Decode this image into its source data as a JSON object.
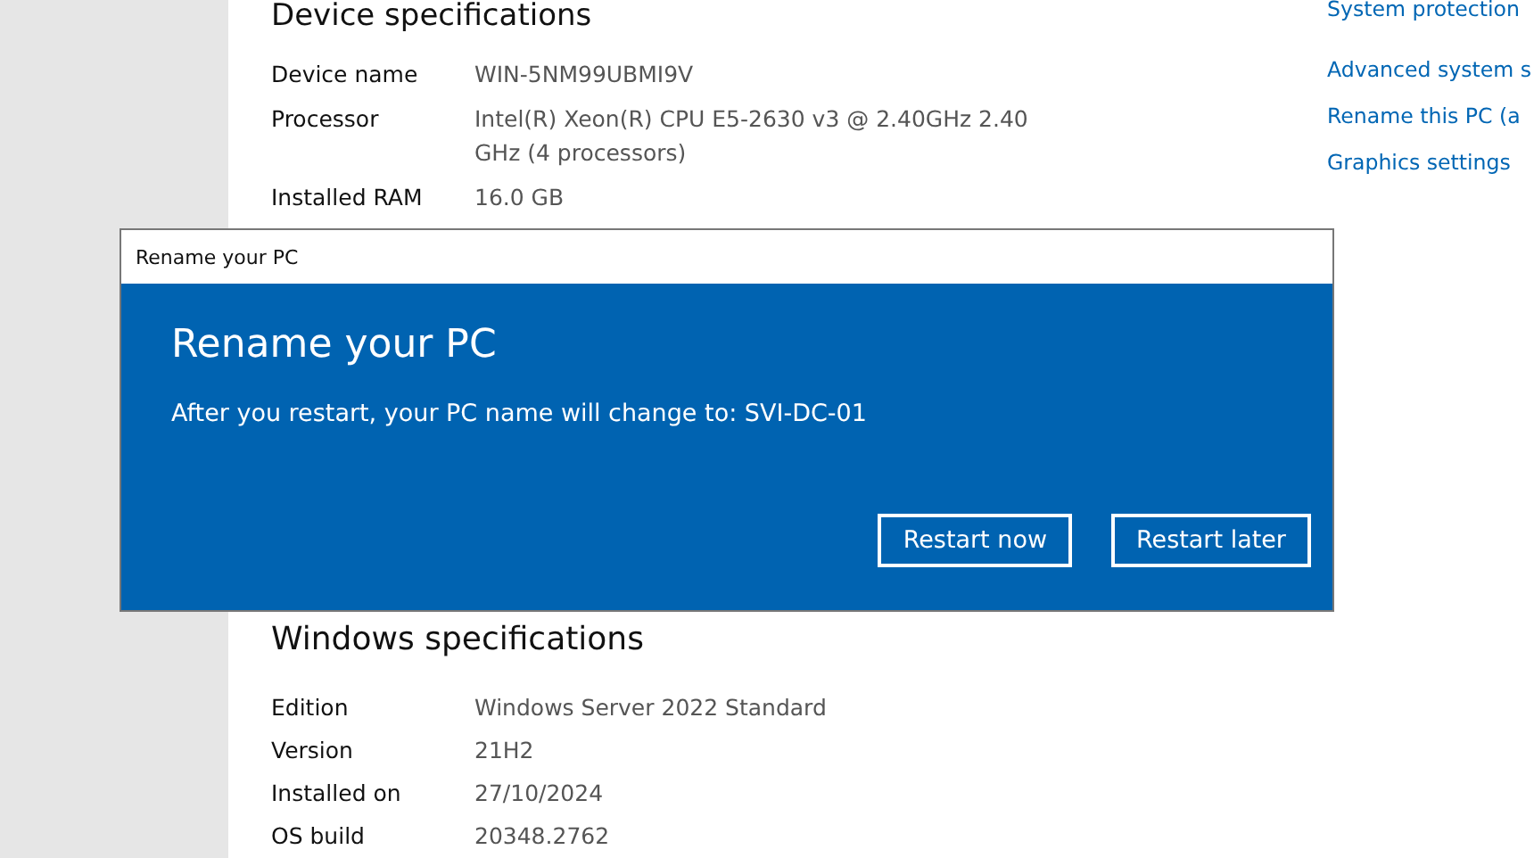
{
  "device_specifications": {
    "heading": "Device specifications",
    "rows": [
      {
        "label": "Device name",
        "value": "WIN-5NM99UBMI9V"
      },
      {
        "label": "Processor",
        "value": "Intel(R) Xeon(R) CPU E5-2630 v3 @ 2.40GHz   2.40 GHz  (4 processors)"
      },
      {
        "label": "Installed RAM",
        "value": "16.0 GB"
      }
    ]
  },
  "related_links": [
    "System protection",
    "Advanced system s",
    "Rename this PC (a",
    "Graphics settings"
  ],
  "dialog": {
    "title": "Rename your PC",
    "heading": "Rename your PC",
    "message": "After you restart, your PC name will change to: SVI-DC-01",
    "buttons": [
      "Restart now",
      "Restart later"
    ]
  },
  "windows_specifications": {
    "heading": "Windows specifications",
    "rows": [
      {
        "label": "Edition",
        "value": "Windows Server 2022 Standard"
      },
      {
        "label": "Version",
        "value": "21H2"
      },
      {
        "label": "Installed on",
        "value": "27/10/2024"
      },
      {
        "label": "OS build",
        "value": "20348.2762"
      }
    ]
  }
}
